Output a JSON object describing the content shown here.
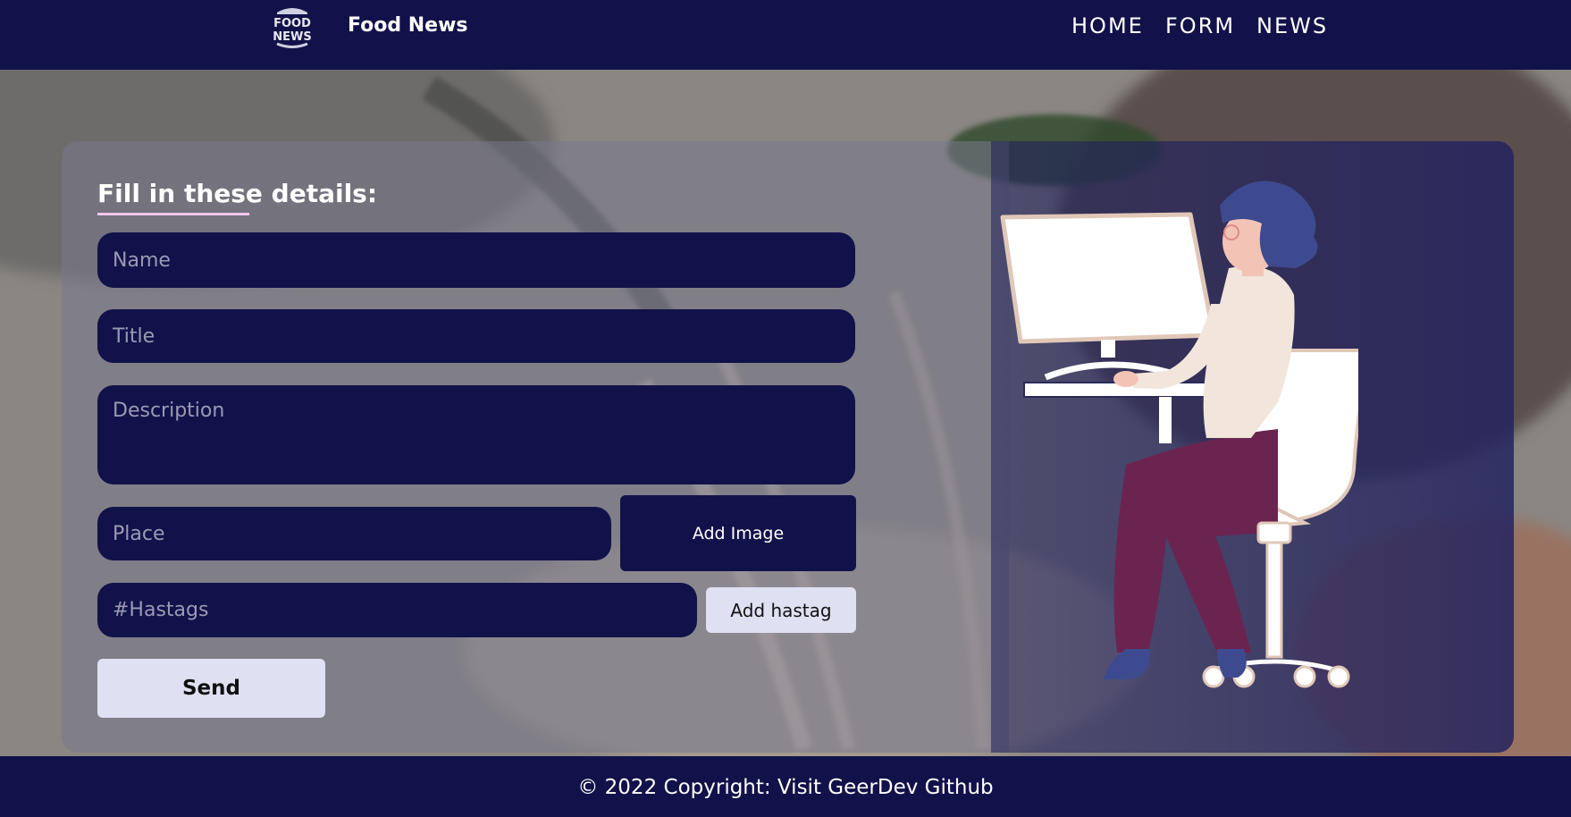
{
  "header": {
    "brand_name": "Food News",
    "logo": {
      "line1": "FOOD",
      "line2": "NEWS"
    },
    "nav": {
      "home": "HOME",
      "form": "FORM",
      "news": "NEWS"
    }
  },
  "form": {
    "heading": "Fill in these details:",
    "name_placeholder": "Name",
    "title_placeholder": "Title",
    "description_placeholder": "Description",
    "place_placeholder": "Place",
    "add_image_label": "Add Image",
    "hashtags_placeholder": "#Hastags",
    "add_hashtag_label": "Add hastag",
    "send_label": "Send"
  },
  "illustration": {
    "icon": "woman-at-computer-illustration"
  },
  "footer": {
    "copyright": "© 2022 Copyright:  Visit GeerDev Github"
  },
  "colors": {
    "navy": "#12124a",
    "light_button": "#dfe1f3",
    "underline_accent": "#f4c6ee",
    "hair": "#3e4a8f",
    "pants": "#6b2450"
  }
}
